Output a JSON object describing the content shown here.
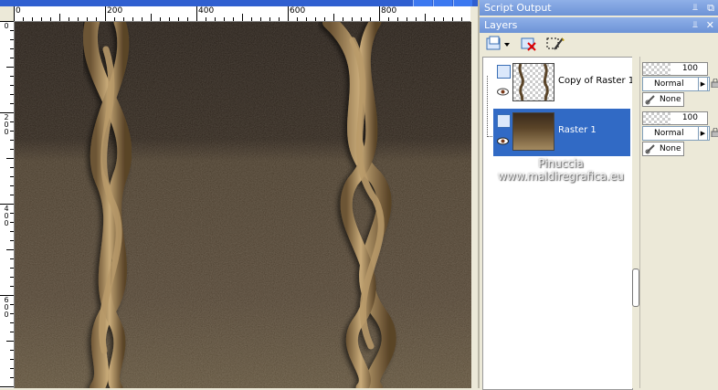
{
  "ruler": {
    "top_labels": [
      "0",
      "200",
      "400",
      "600",
      "800"
    ],
    "left_labels": [
      "0",
      "200",
      "400",
      "600"
    ]
  },
  "palettes": {
    "script_output_title": "Script Output",
    "layers_title": "Layers"
  },
  "layers": [
    {
      "name": "Copy of Raster 1",
      "opacity": "100",
      "blend": "Normal",
      "group": "None",
      "selected": false
    },
    {
      "name": "Raster 1",
      "opacity": "100",
      "blend": "Normal",
      "group": "None",
      "selected": true
    }
  ],
  "watermark": {
    "line1": "Pinuccia",
    "line2": "www.maldiregrafica.eu"
  },
  "colors": {
    "selection": "#316ac5",
    "canvas_top": "#3d2c1e",
    "canvas_bottom": "#9a8158",
    "vine": "#c2a474"
  }
}
